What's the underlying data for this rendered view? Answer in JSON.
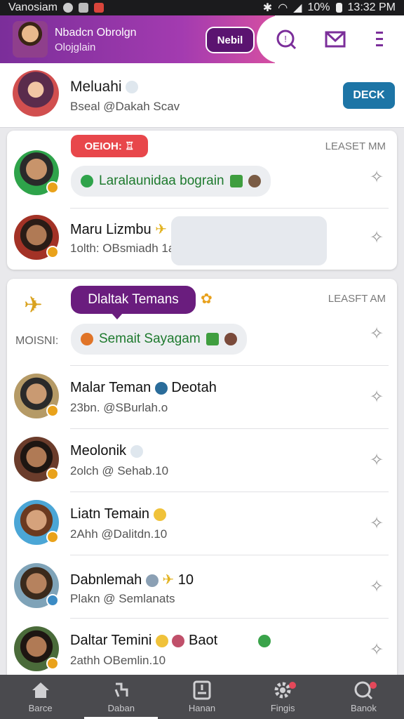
{
  "status_bar": {
    "carrier": "Vanosiam",
    "battery": "10%",
    "time": "13:32 PM"
  },
  "header": {
    "user_name": "Nbadcn Obrolgn",
    "user_sub": "Olojglain",
    "action_button": "Nebil",
    "icons": [
      "search-icon",
      "mail-icon",
      "menu-icon"
    ],
    "accent": "#7b2e9a"
  },
  "profile": {
    "name": "Meluahi",
    "sub": "Bseal @Dakah Scav",
    "button": "DECK"
  },
  "card1": {
    "tag": "OEIOH: ♖",
    "time": "LEASET MM",
    "bubble": "Laralaunidaa bograin",
    "row2_name": "Maru Lizmbu",
    "row2_sub": "1olth: OBsmiadh 1a"
  },
  "card2": {
    "side_label": "MOISNI:",
    "tag": "Dlaltak Temans",
    "time": "LEASFT AM",
    "bubble": "Semait Sayagam",
    "rows": [
      {
        "name": "Malar Teman",
        "extra": "Deotah",
        "sub": "23bn. @SBurlah.o"
      },
      {
        "name": "Meolonik",
        "extra": "",
        "sub": "2olch @ Sehab.10"
      },
      {
        "name": "Liatn Temain",
        "extra": "",
        "sub": "2Ahh @Dalitdn.10"
      },
      {
        "name": "Dabnlemah",
        "extra": "10",
        "sub": "Plakn @ Semlanats"
      },
      {
        "name": "Daltar Temini",
        "extra": "Baot",
        "sub": "2athh OBemlin.10"
      }
    ]
  },
  "bottom_nav": [
    {
      "label": "Barce",
      "icon": "home-icon"
    },
    {
      "label": "Daban",
      "icon": "friends-icon"
    },
    {
      "label": "Hanan",
      "icon": "contacts-icon"
    },
    {
      "label": "Fingis",
      "icon": "settings-icon"
    },
    {
      "label": "Banok",
      "icon": "chat-icon"
    }
  ]
}
